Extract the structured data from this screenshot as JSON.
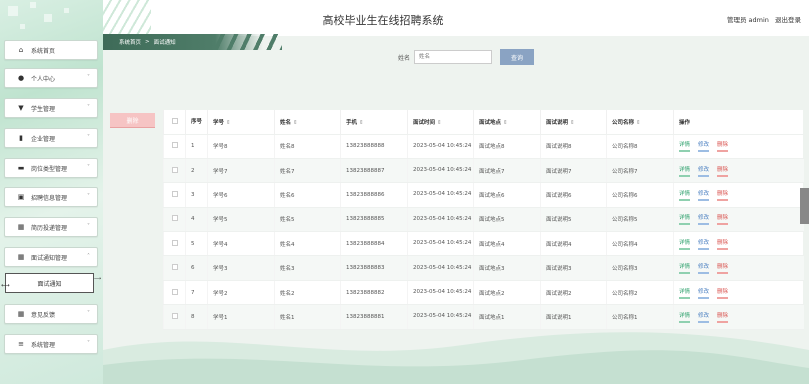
{
  "app": {
    "title": "高校毕业生在线招聘系统"
  },
  "header": {
    "user_label": "管理员 admin",
    "logout": "退出登录"
  },
  "breadcrumb": {
    "home": "系统首页",
    "separator": ">",
    "current": "面试通知"
  },
  "sidebar": {
    "items": [
      {
        "label": "系统首页",
        "icon": "home-icon"
      },
      {
        "label": "个人中心",
        "icon": "user-icon"
      },
      {
        "label": "学生管理",
        "icon": "trophy-icon"
      },
      {
        "label": "企业管理",
        "icon": "bar-chart-icon"
      },
      {
        "label": "岗位类型管理",
        "icon": "folder-icon"
      },
      {
        "label": "招聘信息管理",
        "icon": "clipboard-icon"
      },
      {
        "label": "简历投递管理",
        "icon": "grid-icon"
      },
      {
        "label": "面试通知管理",
        "icon": "grid-icon"
      },
      {
        "label": "意见反馈",
        "icon": "grid-icon"
      },
      {
        "label": "系统管理",
        "icon": "sliders-icon"
      }
    ],
    "sub_item": {
      "label": "面试通知"
    }
  },
  "search": {
    "label": "姓名",
    "placeholder": "姓名",
    "button": "查询"
  },
  "actions": {
    "batch_delete": "删除",
    "detail": "详情",
    "edit": "修改",
    "delete": "删除"
  },
  "table": {
    "headers": [
      "序号",
      "学号",
      "姓名",
      "手机",
      "面试时间",
      "面试地点",
      "面试说明",
      "公司名称",
      "操作"
    ],
    "rows": [
      {
        "no": "1",
        "student_id": "学号8",
        "name": "姓名8",
        "phone": "13823888888",
        "time": "2023-05-04 10:45:24",
        "place": "面试地点8",
        "note": "面试说明8",
        "company": "公司名称8"
      },
      {
        "no": "2",
        "student_id": "学号7",
        "name": "姓名7",
        "phone": "13823888887",
        "time": "2023-05-04 10:45:24",
        "place": "面试地点7",
        "note": "面试说明7",
        "company": "公司名称7"
      },
      {
        "no": "3",
        "student_id": "学号6",
        "name": "姓名6",
        "phone": "13823888886",
        "time": "2023-05-04 10:45:24",
        "place": "面试地点6",
        "note": "面试说明6",
        "company": "公司名称6"
      },
      {
        "no": "4",
        "student_id": "学号5",
        "name": "姓名5",
        "phone": "13823888885",
        "time": "2023-05-04 10:45:24",
        "place": "面试地点5",
        "note": "面试说明5",
        "company": "公司名称5"
      },
      {
        "no": "5",
        "student_id": "学号4",
        "name": "姓名4",
        "phone": "13823888884",
        "time": "2023-05-04 10:45:24",
        "place": "面试地点4",
        "note": "面试说明4",
        "company": "公司名称4"
      },
      {
        "no": "6",
        "student_id": "学号3",
        "name": "姓名3",
        "phone": "13823888883",
        "time": "2023-05-04 10:45:24",
        "place": "面试地点3",
        "note": "面试说明3",
        "company": "公司名称3"
      },
      {
        "no": "7",
        "student_id": "学号2",
        "name": "姓名2",
        "phone": "13823888882",
        "time": "2023-05-04 10:45:24",
        "place": "面试地点2",
        "note": "面试说明2",
        "company": "公司名称2"
      },
      {
        "no": "8",
        "student_id": "学号1",
        "name": "姓名1",
        "phone": "13823888881",
        "time": "2023-05-04 10:45:24",
        "place": "面试地点1",
        "note": "面试说明1",
        "company": "公司名称1"
      }
    ]
  },
  "colors": {
    "accent": "#3e6b58",
    "search_button": "#8aa3c3",
    "delete_button": "#f6c4c4"
  }
}
